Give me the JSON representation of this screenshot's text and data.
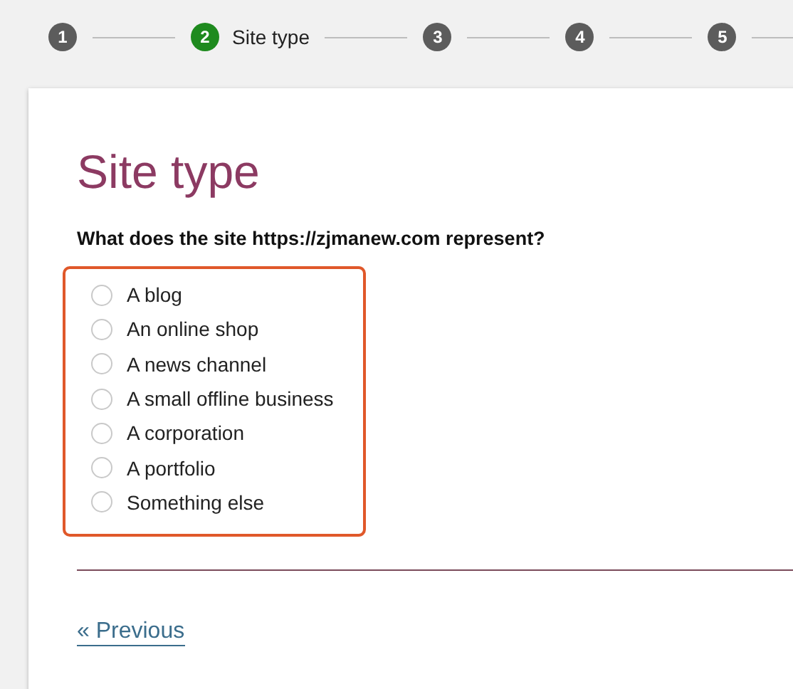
{
  "steps": [
    {
      "number": "1",
      "selected": false
    },
    {
      "number": "2",
      "label": "Site type",
      "selected": true
    },
    {
      "number": "3",
      "selected": false
    },
    {
      "number": "4",
      "selected": false
    },
    {
      "number": "5",
      "selected": false
    }
  ],
  "card": {
    "title": "Site type",
    "question": "What does the site https://zjmanew.com represent?",
    "options": [
      {
        "label": "A blog",
        "selected": false
      },
      {
        "label": "An online shop",
        "selected": false
      },
      {
        "label": "A news channel",
        "selected": false
      },
      {
        "label": "A small offline business",
        "selected": false
      },
      {
        "label": "A corporation",
        "selected": false
      },
      {
        "label": "A portfolio",
        "selected": false
      },
      {
        "label": "Something else",
        "selected": false
      }
    ],
    "previous_link": "« Previous"
  }
}
